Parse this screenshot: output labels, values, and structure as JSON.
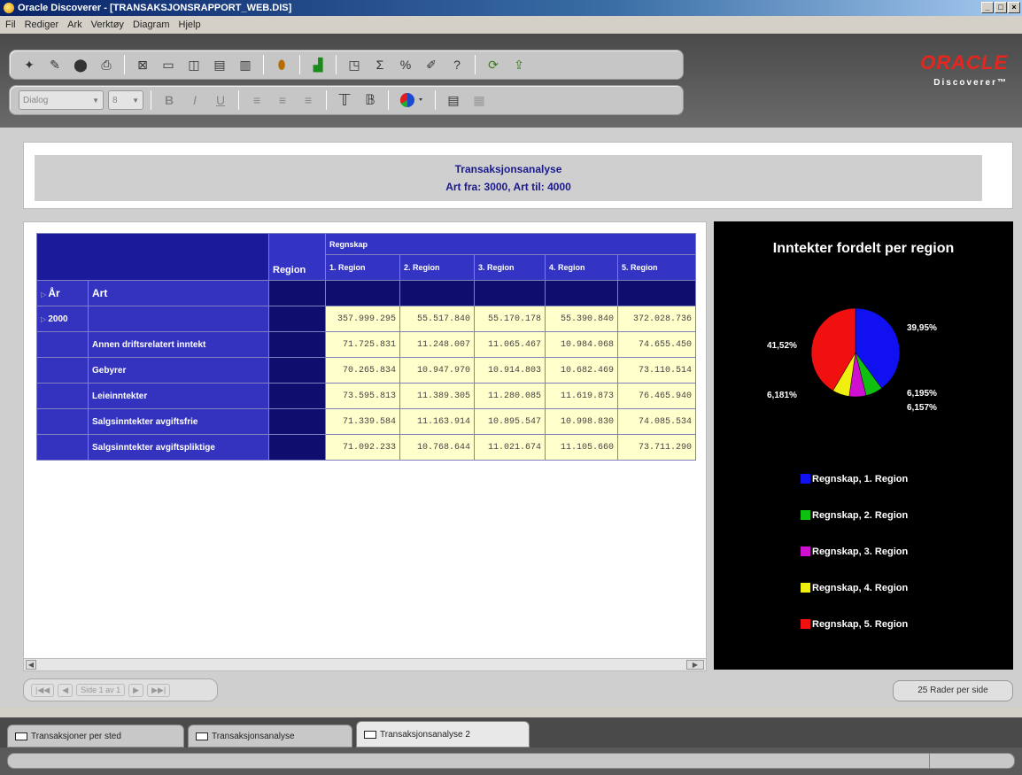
{
  "window": {
    "title": "Oracle Discoverer - [TRANSAKSJONSRAPPORT_WEB.DIS]"
  },
  "menu": [
    "Fil",
    "Rediger",
    "Ark",
    "Verktøy",
    "Diagram",
    "Hjelp"
  ],
  "toolbar2": {
    "font_name": "Dialog",
    "font_size": "8"
  },
  "brand": {
    "oracle": "ORACLE",
    "product": "Discoverer™",
    "accent": "#e6261e"
  },
  "report": {
    "title": "Transaksjonsanalyse",
    "subtitle": "Art fra: 3000, Art til: 4000"
  },
  "table": {
    "top_header": "Regnskap",
    "region_label": "Region",
    "col_headers": [
      "1. Region",
      "2. Region",
      "3. Region",
      "4. Region",
      "5. Region"
    ],
    "row_dim1": "År",
    "row_dim2": "Art",
    "year": "2000",
    "totals": [
      "357.999.295",
      "55.517.840",
      "55.170.178",
      "55.390.840",
      "372.028.736"
    ],
    "rows": [
      {
        "label": "Annen driftsrelatert inntekt",
        "values": [
          "71.725.831",
          "11.248.007",
          "11.065.467",
          "10.984.068",
          "74.655.450"
        ]
      },
      {
        "label": "Gebyrer",
        "values": [
          "70.265.834",
          "10.947.970",
          "10.914.803",
          "10.682.469",
          "73.110.514"
        ]
      },
      {
        "label": "Leieinntekter",
        "values": [
          "73.595.813",
          "11.389.305",
          "11.280.085",
          "11.619.873",
          "76.465.940"
        ]
      },
      {
        "label": "Salgsinntekter avgiftsfrie",
        "values": [
          "71.339.584",
          "11.163.914",
          "10.895.547",
          "10.998.830",
          "74.085.534"
        ]
      },
      {
        "label": "Salgsinntekter avgiftspliktige",
        "values": [
          "71.092.233",
          "10.768.644",
          "11.021.674",
          "11.105.660",
          "73.711.290"
        ]
      }
    ]
  },
  "chart_data": {
    "type": "pie",
    "title": "Inntekter fordelt per region",
    "labels": [
      "Regnskap, 1. Region",
      "Regnskap, 2. Region",
      "Regnskap, 3. Region",
      "Regnskap, 4. Region",
      "Regnskap, 5. Region"
    ],
    "values": [
      39.95,
      6.195,
      6.157,
      6.181,
      41.52
    ],
    "value_labels": [
      "39,95%",
      "6,195%",
      "6,157%",
      "6,181%",
      "41,52%"
    ],
    "colors": [
      "#1010f0",
      "#10c010",
      "#d010d0",
      "#f0f010",
      "#f01010"
    ],
    "legend_position": "bottom"
  },
  "pager": {
    "first": "|◀◀",
    "prev": "◀",
    "page_text": "Side 1 av 1",
    "next": "▶",
    "last": "▶▶|",
    "rows_per_page": "25 Rader per side"
  },
  "tabs": [
    "Transaksjoner per sted",
    "Transaksjonsanalyse",
    "Transaksjonsanalyse 2"
  ]
}
